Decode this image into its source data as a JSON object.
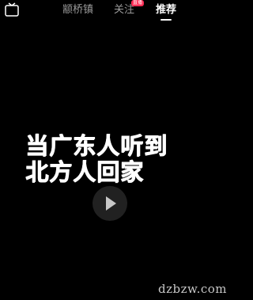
{
  "header": {
    "live_label": "直播",
    "tabs": [
      {
        "label": "颛桥镇",
        "active": false
      },
      {
        "label": "关注",
        "active": false
      },
      {
        "label": "推荐",
        "active": true
      }
    ],
    "follow_badge": "直播"
  },
  "video": {
    "caption_lines": [
      "当广东人听到",
      "北方人回家"
    ]
  },
  "watermark": "dzbzw.com",
  "colors": {
    "background": "#000000",
    "badge": "#fe2c55",
    "inactive_tab": "#9a9a9a"
  }
}
